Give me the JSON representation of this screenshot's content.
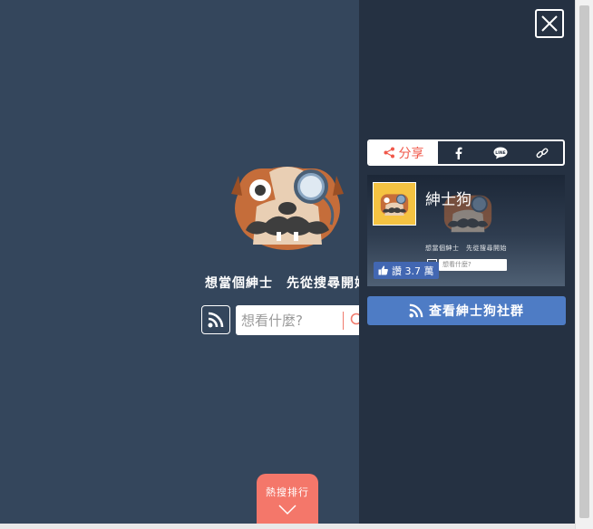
{
  "main": {
    "tagline": "想當個紳士　先從搜尋開始",
    "search_placeholder": "想看什麼?",
    "hot_ranking_label": "熱搜排行"
  },
  "panel": {
    "share": {
      "label": "分享",
      "items": [
        "facebook-icon",
        "line-icon",
        "link-icon"
      ]
    },
    "preview": {
      "title": "紳士狗",
      "tagline": "想當個紳士　先從搜尋開始",
      "search_placeholder": "想看什麼?",
      "like_label": "讚 3.7 萬"
    },
    "community_button_label": "查看紳士狗社群"
  },
  "colors": {
    "background": "#34465c",
    "panel": "#253142",
    "accent": "#f4776a",
    "button_blue": "#4e7cc5",
    "facebook_blue": "#4267b2"
  }
}
